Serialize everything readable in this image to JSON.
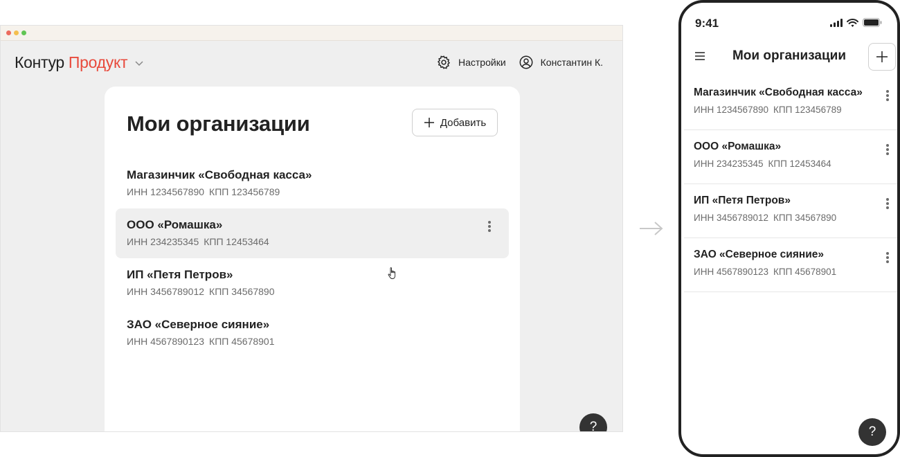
{
  "desktop": {
    "brand": {
      "part1": "Контур",
      "part2": "Продукт"
    },
    "nav": {
      "settings_label": "Настройки",
      "user_label": "Константин К."
    },
    "page_title": "Мои организации",
    "add_button_label": "Добавить",
    "hovered_index": 1
  },
  "organizations": [
    {
      "name": "Магазинчик «Свободная касса»",
      "inn": "ИНН 1234567890",
      "kpp": "КПП 123456789"
    },
    {
      "name": "ООО «Ромашка»",
      "inn": "ИНН 234235345",
      "kpp": "КПП 12453464"
    },
    {
      "name": "ИП «Петя Петров»",
      "inn": "ИНН 3456789012",
      "kpp": "КПП 34567890"
    },
    {
      "name": "ЗАО «Северное сияние»",
      "inn": "ИНН 4567890123",
      "kpp": "КПП 45678901"
    }
  ],
  "mobile": {
    "time": "9:41",
    "title": "Мои организации"
  },
  "help_label": "?",
  "colors": {
    "brand_accent": "#e84a3c",
    "hover_bg": "#efefef",
    "help_bg": "#333333"
  },
  "icons": {
    "settings": "gear-icon",
    "user": "user-icon",
    "add": "plus-icon",
    "more": "kebab-icon",
    "menu": "hamburger-icon"
  }
}
